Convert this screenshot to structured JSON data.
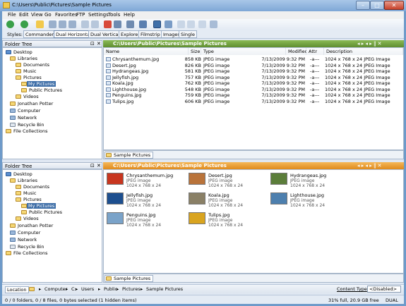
{
  "window": {
    "title": "C:\\Users\\Public\\Pictures\\Sample Pictures",
    "minimize": "–",
    "maximize": "□",
    "close": "✕"
  },
  "menu": [
    "File",
    "Edit",
    "View",
    "Go",
    "Favorites",
    "FTP",
    "Settings",
    "Tools",
    "Help"
  ],
  "styles": {
    "label": "Styles:",
    "tabs": [
      "Commander",
      "Dual Horizontal",
      "Dual Vertical",
      "Explorer",
      "Filmstrip",
      "Images",
      "Single"
    ],
    "active": "Dual Horizontal"
  },
  "folder_tree": {
    "title": "Folder Tree",
    "pin": "⊡",
    "close": "✕",
    "nodes": [
      "Desktop",
      "Libraries",
      "Documents",
      "Music",
      "Pictures",
      "My Pictures",
      "Public Pictures",
      "Videos",
      "Jonathan Potter",
      "Computer",
      "Network",
      "Recycle Bin",
      "File Collections"
    ],
    "selected": "My Pictures"
  },
  "top_pane": {
    "path": "C:\\Users\\Public\\Pictures\\Sample Pictures",
    "nav_glyphs": "◂ ▸ ◂ ▸ ‖ ✕",
    "columns": [
      "Name",
      "Size",
      "Type",
      "Modified",
      "Attr",
      "Description"
    ],
    "files": [
      {
        "name": "Chrysanthemum.jpg",
        "size": "858 KB",
        "type": "JPEG image",
        "modified": "7/13/2009  9:32 PM",
        "attr": "-a---",
        "desc": "1024 x 768 x 24 JPEG Image"
      },
      {
        "name": "Desert.jpg",
        "size": "826 KB",
        "type": "JPEG image",
        "modified": "7/13/2009  9:32 PM",
        "attr": "-a---",
        "desc": "1024 x 768 x 24 JPEG Image"
      },
      {
        "name": "Hydrangeas.jpg",
        "size": "581 KB",
        "type": "JPEG image",
        "modified": "7/13/2009  9:32 PM",
        "attr": "-a---",
        "desc": "1024 x 768 x 24 JPEG Image"
      },
      {
        "name": "Jellyfish.jpg",
        "size": "757 KB",
        "type": "JPEG image",
        "modified": "7/13/2009  9:32 PM",
        "attr": "-a---",
        "desc": "1024 x 768 x 24 JPEG Image"
      },
      {
        "name": "Koala.jpg",
        "size": "762 KB",
        "type": "JPEG image",
        "modified": "7/13/2009  9:32 PM",
        "attr": "-a---",
        "desc": "1024 x 768 x 24 JPEG Image"
      },
      {
        "name": "Lighthouse.jpg",
        "size": "548 KB",
        "type": "JPEG image",
        "modified": "7/13/2009  9:32 PM",
        "attr": "-a---",
        "desc": "1024 x 768 x 24 JPEG Image"
      },
      {
        "name": "Penguins.jpg",
        "size": "759 KB",
        "type": "JPEG image",
        "modified": "7/13/2009  9:32 PM",
        "attr": "-a---",
        "desc": "1024 x 768 x 24 JPEG Image"
      },
      {
        "name": "Tulips.jpg",
        "size": "606 KB",
        "type": "JPEG image",
        "modified": "7/13/2009  9:32 PM",
        "attr": "-a---",
        "desc": "1024 x 768 x 24 JPEG Image"
      }
    ],
    "tab": "Sample Pictures"
  },
  "bottom_pane": {
    "path": "C:\\Users\\Public\\Pictures\\Sample Pictures",
    "thumbs": [
      {
        "name": "Chrysanthemum.jpg",
        "type": "JPEG image",
        "dims": "1024 x 768 x 24",
        "color": "#c8361f"
      },
      {
        "name": "Desert.jpg",
        "type": "JPEG image",
        "dims": "1024 x 768 x 24",
        "color": "#b9733a"
      },
      {
        "name": "Hydrangeas.jpg",
        "type": "JPEG image",
        "dims": "1024 x 768 x 24",
        "color": "#5b7d3a"
      },
      {
        "name": "Jellyfish.jpg",
        "type": "JPEG image",
        "dims": "1024 x 768 x 24",
        "color": "#1d4f8f"
      },
      {
        "name": "Koala.jpg",
        "type": "JPEG image",
        "dims": "1024 x 768 x 24",
        "color": "#8a8066"
      },
      {
        "name": "Lighthouse.jpg",
        "type": "JPEG image",
        "dims": "1024 x 768 x 24",
        "color": "#4d7fae"
      },
      {
        "name": "Penguins.jpg",
        "type": "JPEG image",
        "dims": "1024 x 768 x 24",
        "color": "#7aa3c9"
      },
      {
        "name": "Tulips.jpg",
        "type": "JPEG image",
        "dims": "1024 x 768 x 24",
        "color": "#d9a41f"
      }
    ],
    "tab": "Sample Pictures"
  },
  "location": {
    "label": "Location",
    "crumbs": [
      "Computer",
      "C:",
      "Users",
      "Public",
      "Pictures",
      "Sample Pictures"
    ],
    "separator": "▸",
    "content_type_label": "Content Type",
    "content_type_value": "<Disabled>"
  },
  "status": {
    "left": "0 / 0 folders, 0 / 8 files, 0 bytes selected (1 hidden items)",
    "right": "31% full, 20.9 GB free",
    "mode": "DUAL"
  },
  "colors": {
    "top_path": "#6d9a3a",
    "bottom_path": "#e69c2c",
    "accent": "#3f6fa8"
  }
}
